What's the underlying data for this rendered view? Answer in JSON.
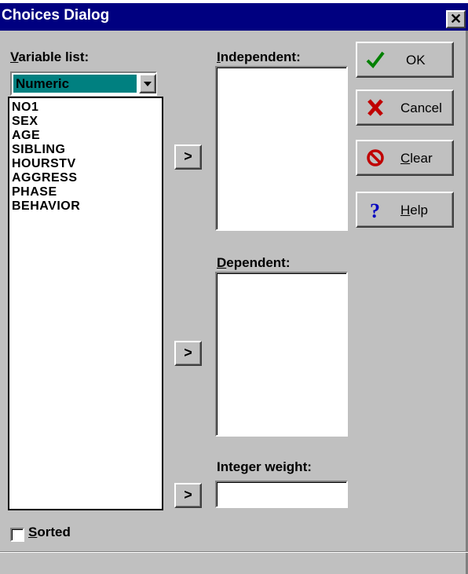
{
  "window": {
    "title": "Choices Dialog",
    "close_glyph": "✕"
  },
  "variable_list": {
    "label_mnemonic": "V",
    "label_rest": "ariable list:",
    "filter_selected": "Numeric",
    "items": [
      "NO1",
      "SEX",
      "AGE",
      "SIBLING",
      "HOURSTV",
      "AGGRESS",
      "PHASE",
      "BEHAVIOR"
    ]
  },
  "independent": {
    "label_mnemonic": "I",
    "label_rest": "ndependent:"
  },
  "dependent": {
    "label_mnemonic": "D",
    "label_rest": "ependent:"
  },
  "weight": {
    "label": "Integer weight:",
    "value": ""
  },
  "move_buttons": {
    "glyph": ">"
  },
  "buttons": {
    "ok": {
      "label": "OK",
      "icon": "green-checkmark-icon"
    },
    "cancel": {
      "label_mnemonic": "",
      "label": "Cancel",
      "icon": "red-x-icon"
    },
    "clear": {
      "label_mnemonic": "C",
      "label_rest": "lear",
      "icon": "red-no-sign-icon"
    },
    "help": {
      "label_mnemonic": "H",
      "label_rest": "elp",
      "icon": "blue-question-icon"
    }
  },
  "sorted": {
    "label_mnemonic": "S",
    "label_rest": "orted",
    "checked": false
  },
  "colors": {
    "titlebar": "#000080",
    "dialog_bg": "#c0c0c0",
    "selection": "#008080",
    "ok_check": "#008000",
    "cancel_x": "#c00000",
    "clear_sign": "#c00000",
    "help_q": "#0000c0"
  }
}
